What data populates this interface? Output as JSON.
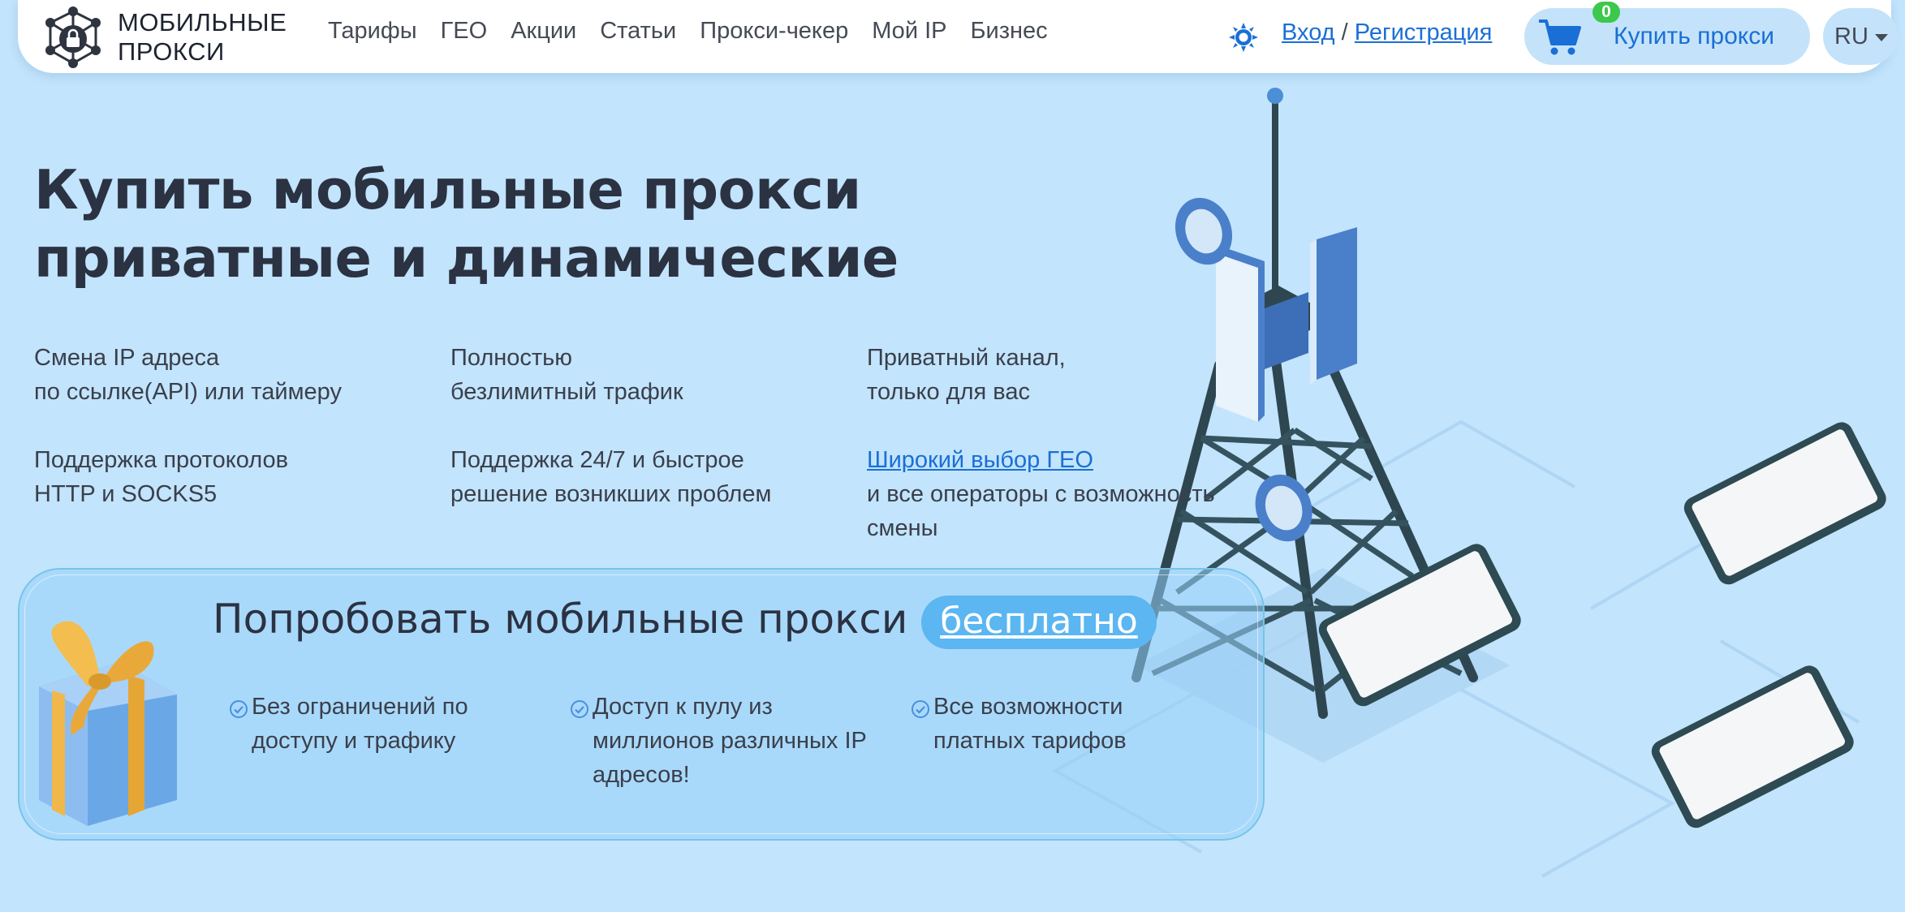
{
  "header": {
    "logo_line1": "МОБИЛЬНЫЕ",
    "logo_line2": "ПРОКСИ",
    "nav": [
      {
        "label": "Тарифы"
      },
      {
        "label": "ГЕО"
      },
      {
        "label": "Акции"
      },
      {
        "label": "Статьи"
      },
      {
        "label": "Прокси-чекер"
      },
      {
        "label": "Мой IP"
      },
      {
        "label": "Бизнес"
      }
    ],
    "login": "Вход",
    "separator": "/",
    "register": "Регистрация",
    "cart_count": "0",
    "buy_label": "Купить прокси",
    "language": "RU"
  },
  "hero": {
    "title_line1": "Купить мобильные прокси",
    "title_line2": "приватные и динамические",
    "features": [
      {
        "line1": "Смена IP адреса",
        "line2": "по ссылке(API) или таймеру"
      },
      {
        "line1": "Полностью",
        "line2": "безлимитный трафик"
      },
      {
        "line1": "Приватный канал,",
        "line2": "только для вас"
      },
      {
        "line1": "Поддержка протоколов",
        "line2": "HTTP и SOCKS5"
      },
      {
        "line1": "Поддержка 24/7 и быстрое",
        "line2": "решение возникших проблем"
      },
      {
        "link": "Широкий выбор ГЕО",
        "line2": "и все операторы с возможность",
        "line3": "смены"
      }
    ]
  },
  "trial": {
    "title": "Попробовать мобильные прокси",
    "free_label": "бесплатно",
    "benefits": [
      {
        "line1": "Без ограничений по",
        "line2": "доступу и трафику"
      },
      {
        "line1": "Доступ к пулу из",
        "line2": "миллионов различных IP",
        "line3": "адресов!"
      },
      {
        "line1": "Все возможности",
        "line2": "платных тарифов"
      }
    ]
  },
  "colors": {
    "background": "#c2e4fc",
    "accent": "#1a6fd6",
    "badge": "#3cc84d",
    "pill": "#5bb6f2"
  }
}
